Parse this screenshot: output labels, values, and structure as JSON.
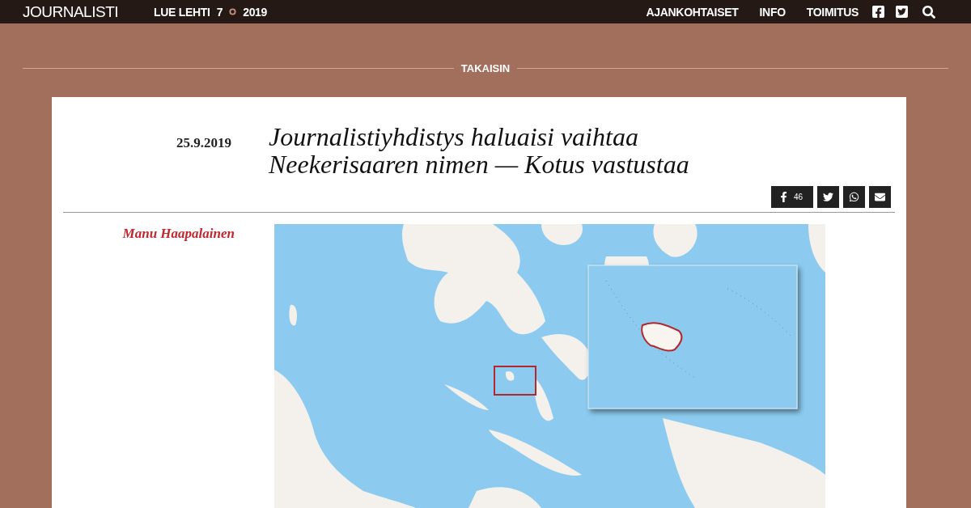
{
  "top_bar": {
    "logo": "JOURNALISTI",
    "issue": {
      "label": "LUE LEHTI",
      "number": "7",
      "year": "2019"
    },
    "nav": [
      "AJANKOHTAISET",
      "INFO",
      "TOIMITUS"
    ]
  },
  "back_link": "TAKAISIN",
  "article": {
    "date": "25.9.2019",
    "title": "Journalistiyhdistys haluaisi vaihtaa Neekerisaaren nimen — Kotus vastustaa",
    "share": [
      {
        "kind": "facebook",
        "count": "46"
      },
      {
        "kind": "twitter"
      },
      {
        "kind": "whatsapp"
      },
      {
        "kind": "email"
      }
    ],
    "author": "Manu Haapalainen"
  }
}
